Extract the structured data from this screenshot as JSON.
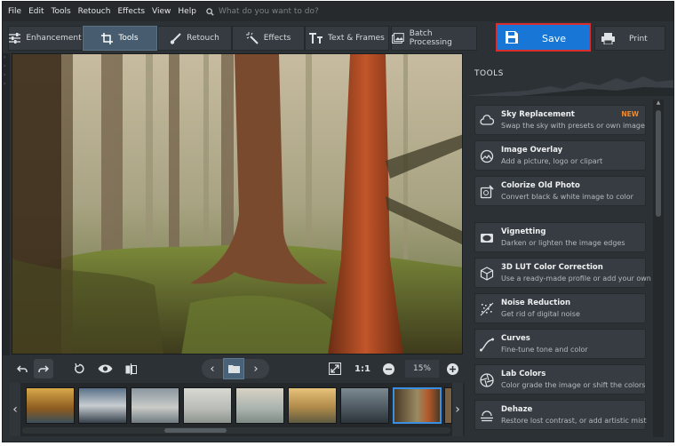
{
  "menu": [
    "File",
    "Edit",
    "Tools",
    "Retouch",
    "Effects",
    "View",
    "Help"
  ],
  "search": {
    "placeholder": "What do you want to do?"
  },
  "tabs": [
    {
      "label": "Enhancement",
      "icon": "sliders-icon",
      "active": false
    },
    {
      "label": "Tools",
      "icon": "crop-icon",
      "active": true
    },
    {
      "label": "Retouch",
      "icon": "brush-icon",
      "active": false
    },
    {
      "label": "Effects",
      "icon": "magic-wand-icon",
      "active": false
    },
    {
      "label": "Text & Frames",
      "icon": "text-icon",
      "active": false
    }
  ],
  "batch": {
    "label": "Batch Processing",
    "icon": "batch-icon"
  },
  "save": {
    "label": "Save",
    "icon": "floppy-disk-icon"
  },
  "print": {
    "label": "Print",
    "icon": "printer-icon"
  },
  "zoom": {
    "ratio_label": "1:1",
    "value": "15%"
  },
  "panel": {
    "title": "TOOLS",
    "items": [
      {
        "title": "Sky Replacement",
        "desc": "Swap the sky with presets or own image",
        "badge": "NEW",
        "icon": "cloud-icon"
      },
      {
        "title": "Image Overlay",
        "desc": "Add a picture, logo or clipart",
        "icon": "overlay-icon"
      },
      {
        "title": "Colorize Old Photo",
        "desc": "Convert black & white image to color",
        "icon": "colorize-icon"
      },
      {
        "title": "Vignetting",
        "desc": "Darken or lighten the image edges",
        "icon": "vignette-icon"
      },
      {
        "title": "3D LUT Color Correction",
        "desc": "Use a ready-made profile or add your own",
        "icon": "cube-icon"
      },
      {
        "title": "Noise Reduction",
        "desc": "Get rid of digital noise",
        "icon": "noise-icon"
      },
      {
        "title": "Curves",
        "desc": "Fine-tune tone and color",
        "icon": "curves-icon"
      },
      {
        "title": "Lab Colors",
        "desc": "Color grade the image or shift the colors",
        "icon": "aperture-icon"
      },
      {
        "title": "Dehaze",
        "desc": "Restore lost contrast, or add artistic mist",
        "icon": "dehaze-icon"
      }
    ]
  },
  "colors": {
    "accent": "#1877d6",
    "save_outline": "#d92e2e",
    "badge": "#f08a2a",
    "active_tab": "#475d6f"
  }
}
